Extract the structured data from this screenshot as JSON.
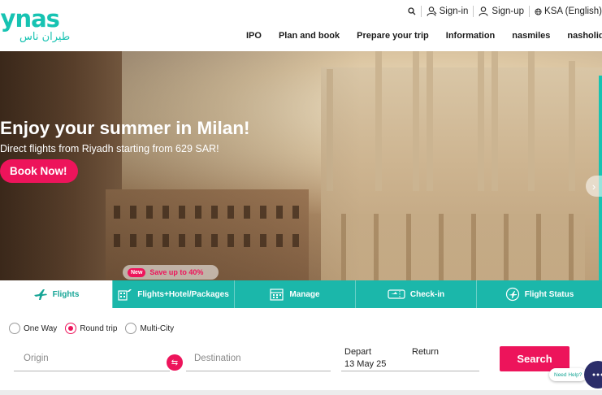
{
  "brand": {
    "logo_text": "flynas",
    "logo_arabic": "طيران ناس"
  },
  "topbar": {
    "search_icon": "search-icon",
    "signin_label": "Sign-in",
    "signup_label": "Sign-up",
    "locale_label": "KSA (English)"
  },
  "nav": {
    "items": [
      {
        "label": "IPO"
      },
      {
        "label": "Plan and book"
      },
      {
        "label": "Prepare your trip"
      },
      {
        "label": "Information"
      },
      {
        "label": "nasmiles"
      },
      {
        "label": "nasholiday"
      }
    ]
  },
  "hero": {
    "title": "Enjoy your summer in Milan!",
    "subtitle": "Direct flights from Riyadh starting from 629 SAR!",
    "cta_label": "Book Now!",
    "promo_badge": "New",
    "promo_text": "Save up to 40%",
    "next_icon": "chevron-right-icon"
  },
  "tabs": [
    {
      "label": "Flights",
      "icon": "plane-icon",
      "active": true
    },
    {
      "label": "Flights+Hotel/Packages",
      "icon": "hotel-icon",
      "active": false
    },
    {
      "label": "Manage",
      "icon": "calendar-icon",
      "active": false
    },
    {
      "label": "Check-in",
      "icon": "ticket-icon",
      "active": false
    },
    {
      "label": "Flight Status",
      "icon": "flight-status-icon",
      "active": false
    }
  ],
  "booking": {
    "trip_types": [
      {
        "label": "One Way",
        "selected": false
      },
      {
        "label": "Round trip",
        "selected": true
      },
      {
        "label": "Multi-City",
        "selected": false
      }
    ],
    "origin_placeholder": "Origin",
    "destination_placeholder": "Destination",
    "depart_label": "Depart",
    "depart_value": "13 May 25",
    "return_label": "Return",
    "return_value": "",
    "search_label": "Search"
  },
  "help": {
    "bubble_text": "Need Help?"
  },
  "colors": {
    "brand_teal": "#17c3b2",
    "accent_pink": "#ed145b",
    "chat_navy": "#2b2d69"
  }
}
